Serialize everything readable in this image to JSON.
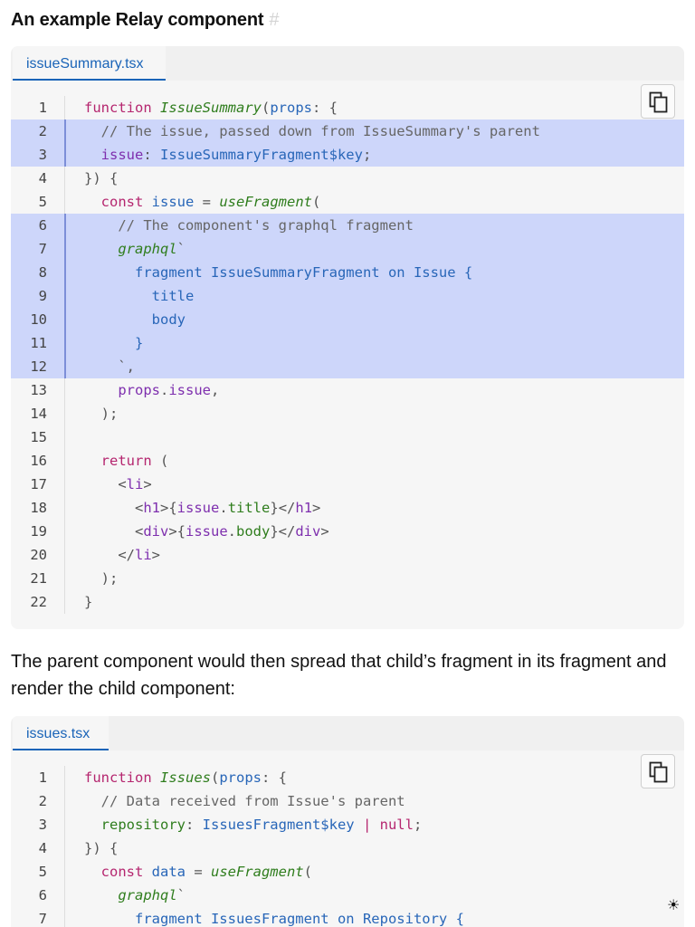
{
  "heading": {
    "text": "An example Relay component",
    "anchor": "#"
  },
  "block1": {
    "tab": "issueSummary.tsx",
    "lines": [
      {
        "n": "1",
        "hl": false,
        "t": [
          [
            "kw",
            "function "
          ],
          [
            "fn",
            "IssueSummary"
          ],
          [
            "pu",
            "("
          ],
          [
            "pr",
            "props"
          ],
          [
            "pu",
            ": {"
          ]
        ]
      },
      {
        "n": "2",
        "hl": true,
        "t": [
          [
            "cm",
            "  // The issue, passed down from IssueSummary's parent"
          ]
        ]
      },
      {
        "n": "3",
        "hl": true,
        "t": [
          [
            "pp",
            "  issue"
          ],
          [
            "pu",
            ": "
          ],
          [
            "ty",
            "IssueSummaryFragment$key"
          ],
          [
            "pu",
            ";"
          ]
        ]
      },
      {
        "n": "4",
        "hl": false,
        "t": [
          [
            "pu",
            "}) {"
          ]
        ]
      },
      {
        "n": "5",
        "hl": false,
        "t": [
          [
            "kw",
            "  const "
          ],
          [
            "pr",
            "issue"
          ],
          [
            "pu",
            " = "
          ],
          [
            "fn",
            "useFragment"
          ],
          [
            "pu",
            "("
          ]
        ]
      },
      {
        "n": "6",
        "hl": true,
        "t": [
          [
            "cm",
            "    // The component's graphql fragment"
          ]
        ]
      },
      {
        "n": "7",
        "hl": true,
        "t": [
          [
            "fn",
            "    graphql"
          ],
          [
            "pu",
            "`"
          ]
        ]
      },
      {
        "n": "8",
        "hl": true,
        "t": [
          [
            "ty",
            "      fragment IssueSummaryFragment on Issue {"
          ]
        ]
      },
      {
        "n": "9",
        "hl": true,
        "t": [
          [
            "ty",
            "        title"
          ]
        ]
      },
      {
        "n": "10",
        "hl": true,
        "t": [
          [
            "ty",
            "        body"
          ]
        ]
      },
      {
        "n": "11",
        "hl": true,
        "t": [
          [
            "ty",
            "      }"
          ]
        ]
      },
      {
        "n": "12",
        "hl": true,
        "t": [
          [
            "pu",
            "    `,"
          ]
        ]
      },
      {
        "n": "13",
        "hl": false,
        "t": [
          [
            "pp",
            "    props"
          ],
          [
            "pu",
            "."
          ],
          [
            "pp",
            "issue"
          ],
          [
            "pu",
            ","
          ]
        ]
      },
      {
        "n": "14",
        "hl": false,
        "t": [
          [
            "pu",
            "  );"
          ]
        ]
      },
      {
        "n": "15",
        "hl": false,
        "t": []
      },
      {
        "n": "16",
        "hl": false,
        "t": [
          [
            "kw",
            "  return "
          ],
          [
            "pu",
            "("
          ]
        ]
      },
      {
        "n": "17",
        "hl": false,
        "t": [
          [
            "pu",
            "    <"
          ],
          [
            "tg",
            "li"
          ],
          [
            "pu",
            ">"
          ]
        ]
      },
      {
        "n": "18",
        "hl": false,
        "t": [
          [
            "pu",
            "      <"
          ],
          [
            "tg",
            "h1"
          ],
          [
            "pu",
            ">{"
          ],
          [
            "pp",
            "issue"
          ],
          [
            "pu",
            "."
          ],
          [
            "gr",
            "title"
          ],
          [
            "pu",
            "}</"
          ],
          [
            "tg",
            "h1"
          ],
          [
            "pu",
            ">"
          ]
        ]
      },
      {
        "n": "19",
        "hl": false,
        "t": [
          [
            "pu",
            "      <"
          ],
          [
            "tg",
            "div"
          ],
          [
            "pu",
            ">{"
          ],
          [
            "pp",
            "issue"
          ],
          [
            "pu",
            "."
          ],
          [
            "gr",
            "body"
          ],
          [
            "pu",
            "}</"
          ],
          [
            "tg",
            "div"
          ],
          [
            "pu",
            ">"
          ]
        ]
      },
      {
        "n": "20",
        "hl": false,
        "t": [
          [
            "pu",
            "    </"
          ],
          [
            "tg",
            "li"
          ],
          [
            "pu",
            ">"
          ]
        ]
      },
      {
        "n": "21",
        "hl": false,
        "t": [
          [
            "pu",
            "  );"
          ]
        ]
      },
      {
        "n": "22",
        "hl": false,
        "t": [
          [
            "pu",
            "}"
          ]
        ]
      }
    ]
  },
  "paragraph": "The parent component would then spread that child’s fragment in its fragment and render the child component:",
  "block2": {
    "tab": "issues.tsx",
    "lines": [
      {
        "n": "1",
        "hl": false,
        "t": [
          [
            "kw",
            "function "
          ],
          [
            "fn",
            "Issues"
          ],
          [
            "pu",
            "("
          ],
          [
            "pr",
            "props"
          ],
          [
            "pu",
            ": {"
          ]
        ]
      },
      {
        "n": "2",
        "hl": false,
        "t": [
          [
            "cm",
            "  // Data received from Issue's parent"
          ]
        ]
      },
      {
        "n": "3",
        "hl": false,
        "t": [
          [
            "gr",
            "  repository"
          ],
          [
            "pu",
            ": "
          ],
          [
            "ty",
            "IssuesFragment$key"
          ],
          [
            "kw",
            " | "
          ],
          [
            "kw",
            "null"
          ],
          [
            "pu",
            ";"
          ]
        ]
      },
      {
        "n": "4",
        "hl": false,
        "t": [
          [
            "pu",
            "}) {"
          ]
        ]
      },
      {
        "n": "5",
        "hl": false,
        "t": [
          [
            "kw",
            "  const "
          ],
          [
            "pr",
            "data"
          ],
          [
            "pu",
            " = "
          ],
          [
            "fn",
            "useFragment"
          ],
          [
            "pu",
            "("
          ]
        ]
      },
      {
        "n": "6",
        "hl": false,
        "t": [
          [
            "fn",
            "    graphql"
          ],
          [
            "pu",
            "`"
          ]
        ]
      },
      {
        "n": "7",
        "hl": false,
        "t": [
          [
            "ty",
            "      fragment IssuesFragment on Repository {"
          ]
        ]
      }
    ]
  },
  "icons": {
    "copy": "copy-icon",
    "theme": "sun-icon"
  },
  "colors": {
    "accent": "#1a64b8",
    "highlight": "#cdd6fa",
    "code_bg": "#f6f6f6"
  }
}
